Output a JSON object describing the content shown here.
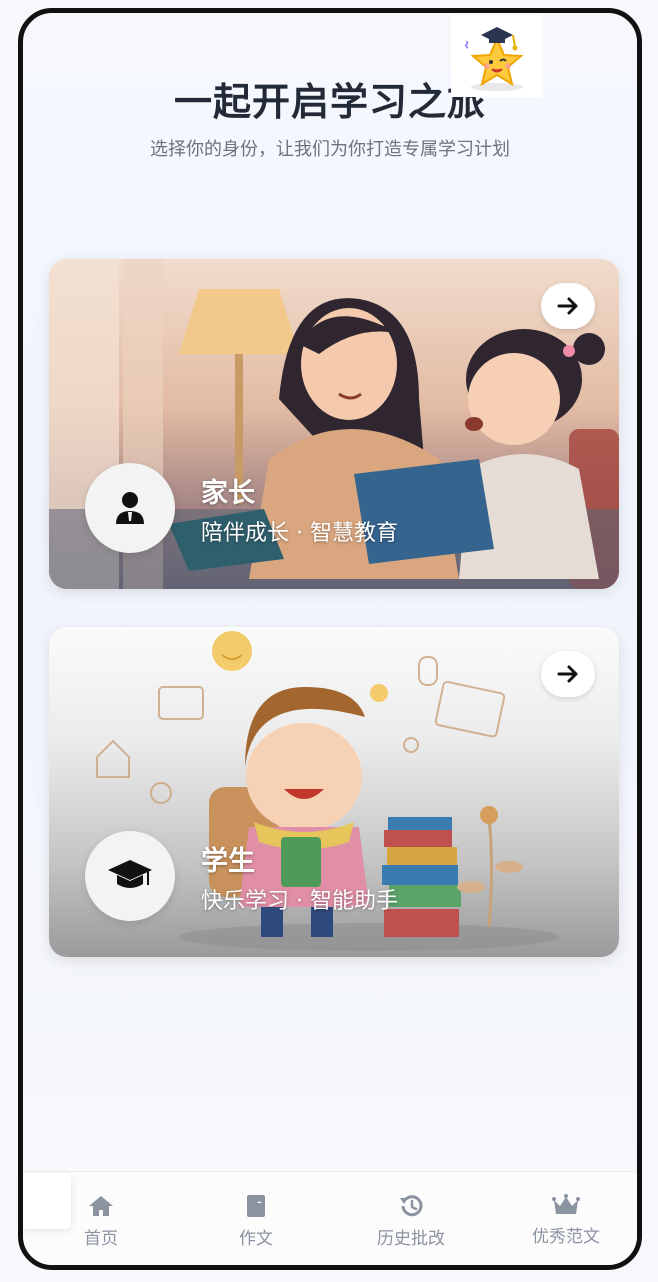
{
  "header": {
    "title": "一起开启学习之旅",
    "subtitle": "选择你的身份，让我们为你打造专属学习计划"
  },
  "roles": [
    {
      "name": "家长",
      "description": "陪伴成长 · 智慧教育",
      "icon": "user-tie-icon"
    },
    {
      "name": "学生",
      "description": "快乐学习 · 智能助手",
      "icon": "graduation-cap-icon"
    }
  ],
  "tabbar": {
    "items": [
      {
        "label": "首页",
        "icon": "home-icon"
      },
      {
        "label": "作文",
        "icon": "book-icon"
      },
      {
        "label": "历史批改",
        "icon": "history-icon"
      },
      {
        "label": "优秀范文",
        "icon": "crown-icon"
      }
    ]
  },
  "colors": {
    "title": "#222a37",
    "subtitle": "#6b7280",
    "tab_label": "#8b93a1"
  }
}
